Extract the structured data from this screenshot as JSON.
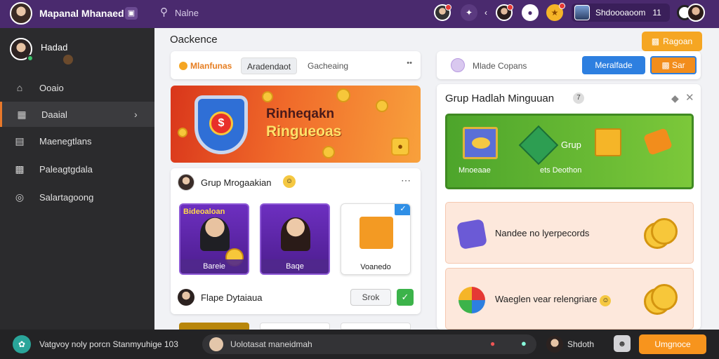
{
  "topbar": {
    "title": "Mapanal Mhanaed",
    "search_label": "Nalne",
    "profile_name": "Shdoooaoom",
    "profile_count": "11",
    "icons": [
      "avatar-notification",
      "settings-icon",
      "user-notification",
      "chat-icon",
      "coin-icon"
    ]
  },
  "sidebar": {
    "user_name": "Hadad",
    "items": [
      {
        "label": "Ooaio",
        "icon": "home-icon"
      },
      {
        "label": "Daaial",
        "icon": "bookmark-icon"
      },
      {
        "label": "Maenegtlans",
        "icon": "document-icon"
      },
      {
        "label": "Paleagtgdala",
        "icon": "briefcase-icon"
      },
      {
        "label": "Salartagoong",
        "icon": "settings-icon"
      }
    ],
    "active_index": 1
  },
  "main": {
    "page_title": "Oackence",
    "top_button": "Ragoan",
    "tabs": {
      "active": "Mlanfunas",
      "pill": "Aradendaot",
      "plain": "Gacheaing",
      "more": "••"
    },
    "banner": {
      "line1": "Rinheqakn",
      "line2": "Ringueoas"
    },
    "group_card": {
      "title": "Grup Mrogaakian",
      "tiles": [
        {
          "heading": "Bideoaloan",
          "caption": "Bareie"
        },
        {
          "heading": "",
          "caption": "Baqe"
        },
        {
          "heading": "",
          "caption": "Voanedo"
        }
      ],
      "row_label": "Flape Dytaiaua",
      "row_button": "Srok"
    },
    "right_top": {
      "label": "Mlade Copans",
      "blue_button": "Meralfade",
      "orange_button": "Sar"
    },
    "panel": {
      "title": "Grup Hadlah Minguuan",
      "green_banner": {
        "word": "Grup",
        "caption1": "Mnoeaae",
        "caption2": "ets Deothon"
      },
      "promos": [
        {
          "label": "Nandee no lyerpecords"
        },
        {
          "label": "Waeglen vear relengriare"
        }
      ]
    }
  },
  "bottombar": {
    "text": "Vatgvoy noly porcn Stanmyuhige 103",
    "input_value": "Uolotasat maneidmah",
    "user_name": "Shdoth",
    "cta_label": "Umgnoce"
  },
  "colors": {
    "topbar": "#4a2a6e",
    "sidebar": "#2b2b2d",
    "accent_orange": "#f7941d",
    "accent_blue": "#2d7fe0",
    "accent_green": "#4da52b"
  }
}
